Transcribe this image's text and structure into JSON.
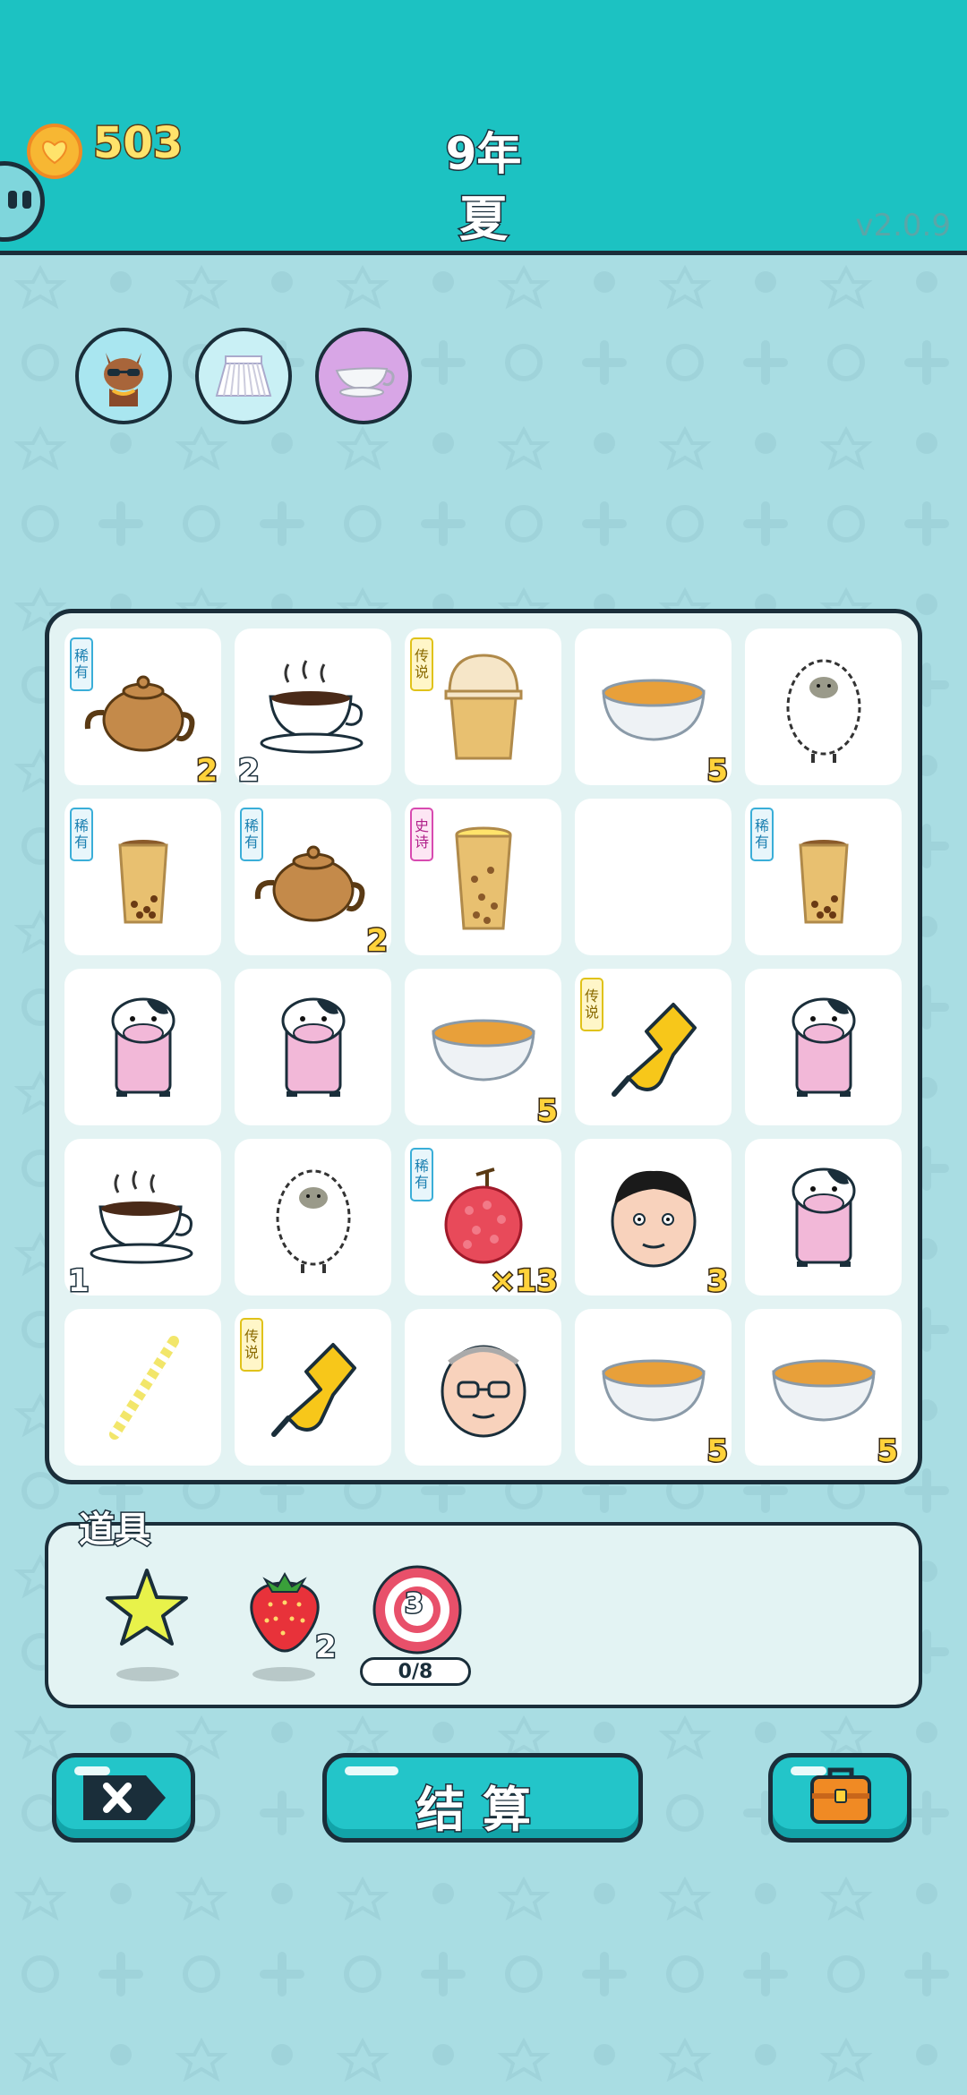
{
  "header": {
    "coins": "503",
    "coin_icon": "heart-coin-icon",
    "year": "9年",
    "season": "夏",
    "version": "v2.0.9",
    "bg_color": "#1cc2c2"
  },
  "buffs": [
    {
      "icon": "cat-sunglasses-icon",
      "bg": "#a9e6f0"
    },
    {
      "icon": "pleated-skirt-icon",
      "bg": "#c9f0f5"
    },
    {
      "icon": "gravy-boat-icon",
      "bg": "#d8a6e6"
    }
  ],
  "board": {
    "cells": [
      {
        "item": "teapot",
        "tag": "稀有",
        "count": "2"
      },
      {
        "item": "coffee-cup",
        "count_left": "2"
      },
      {
        "item": "dome-cup",
        "tag": "传说"
      },
      {
        "item": "soup-bowl",
        "count": "5"
      },
      {
        "item": "sheep"
      },
      {
        "item": "boba-cup",
        "tag": "稀有"
      },
      {
        "item": "teapot",
        "tag": "稀有",
        "count": "2"
      },
      {
        "item": "boba-cup-lid",
        "tag": "史诗"
      },
      {
        "item": "empty"
      },
      {
        "item": "boba-cup",
        "tag": "稀有"
      },
      {
        "item": "cow"
      },
      {
        "item": "cow"
      },
      {
        "item": "soup-bowl",
        "count": "5"
      },
      {
        "item": "pointing-hand",
        "tag": "传说"
      },
      {
        "item": "cow"
      },
      {
        "item": "coffee-cup",
        "count_left": "1"
      },
      {
        "item": "sheep"
      },
      {
        "item": "lychee",
        "tag": "稀有",
        "count": "×13"
      },
      {
        "item": "man-face",
        "count": "3"
      },
      {
        "item": "cow"
      },
      {
        "item": "straw"
      },
      {
        "item": "pointing-hand",
        "tag": "传说"
      },
      {
        "item": "old-man-face"
      },
      {
        "item": "soup-bowl",
        "count": "5"
      },
      {
        "item": "soup-bowl",
        "count": "5"
      }
    ]
  },
  "tools": {
    "label": "道具",
    "items": [
      {
        "icon": "star-icon"
      },
      {
        "icon": "strawberry-icon",
        "count": "2"
      },
      {
        "icon": "target-icon",
        "badge": "3",
        "progress": "0/8"
      }
    ]
  },
  "actions": {
    "exit_icon": "exit-x-icon",
    "settle_label": "结算",
    "bag_icon": "briefcase-icon"
  }
}
